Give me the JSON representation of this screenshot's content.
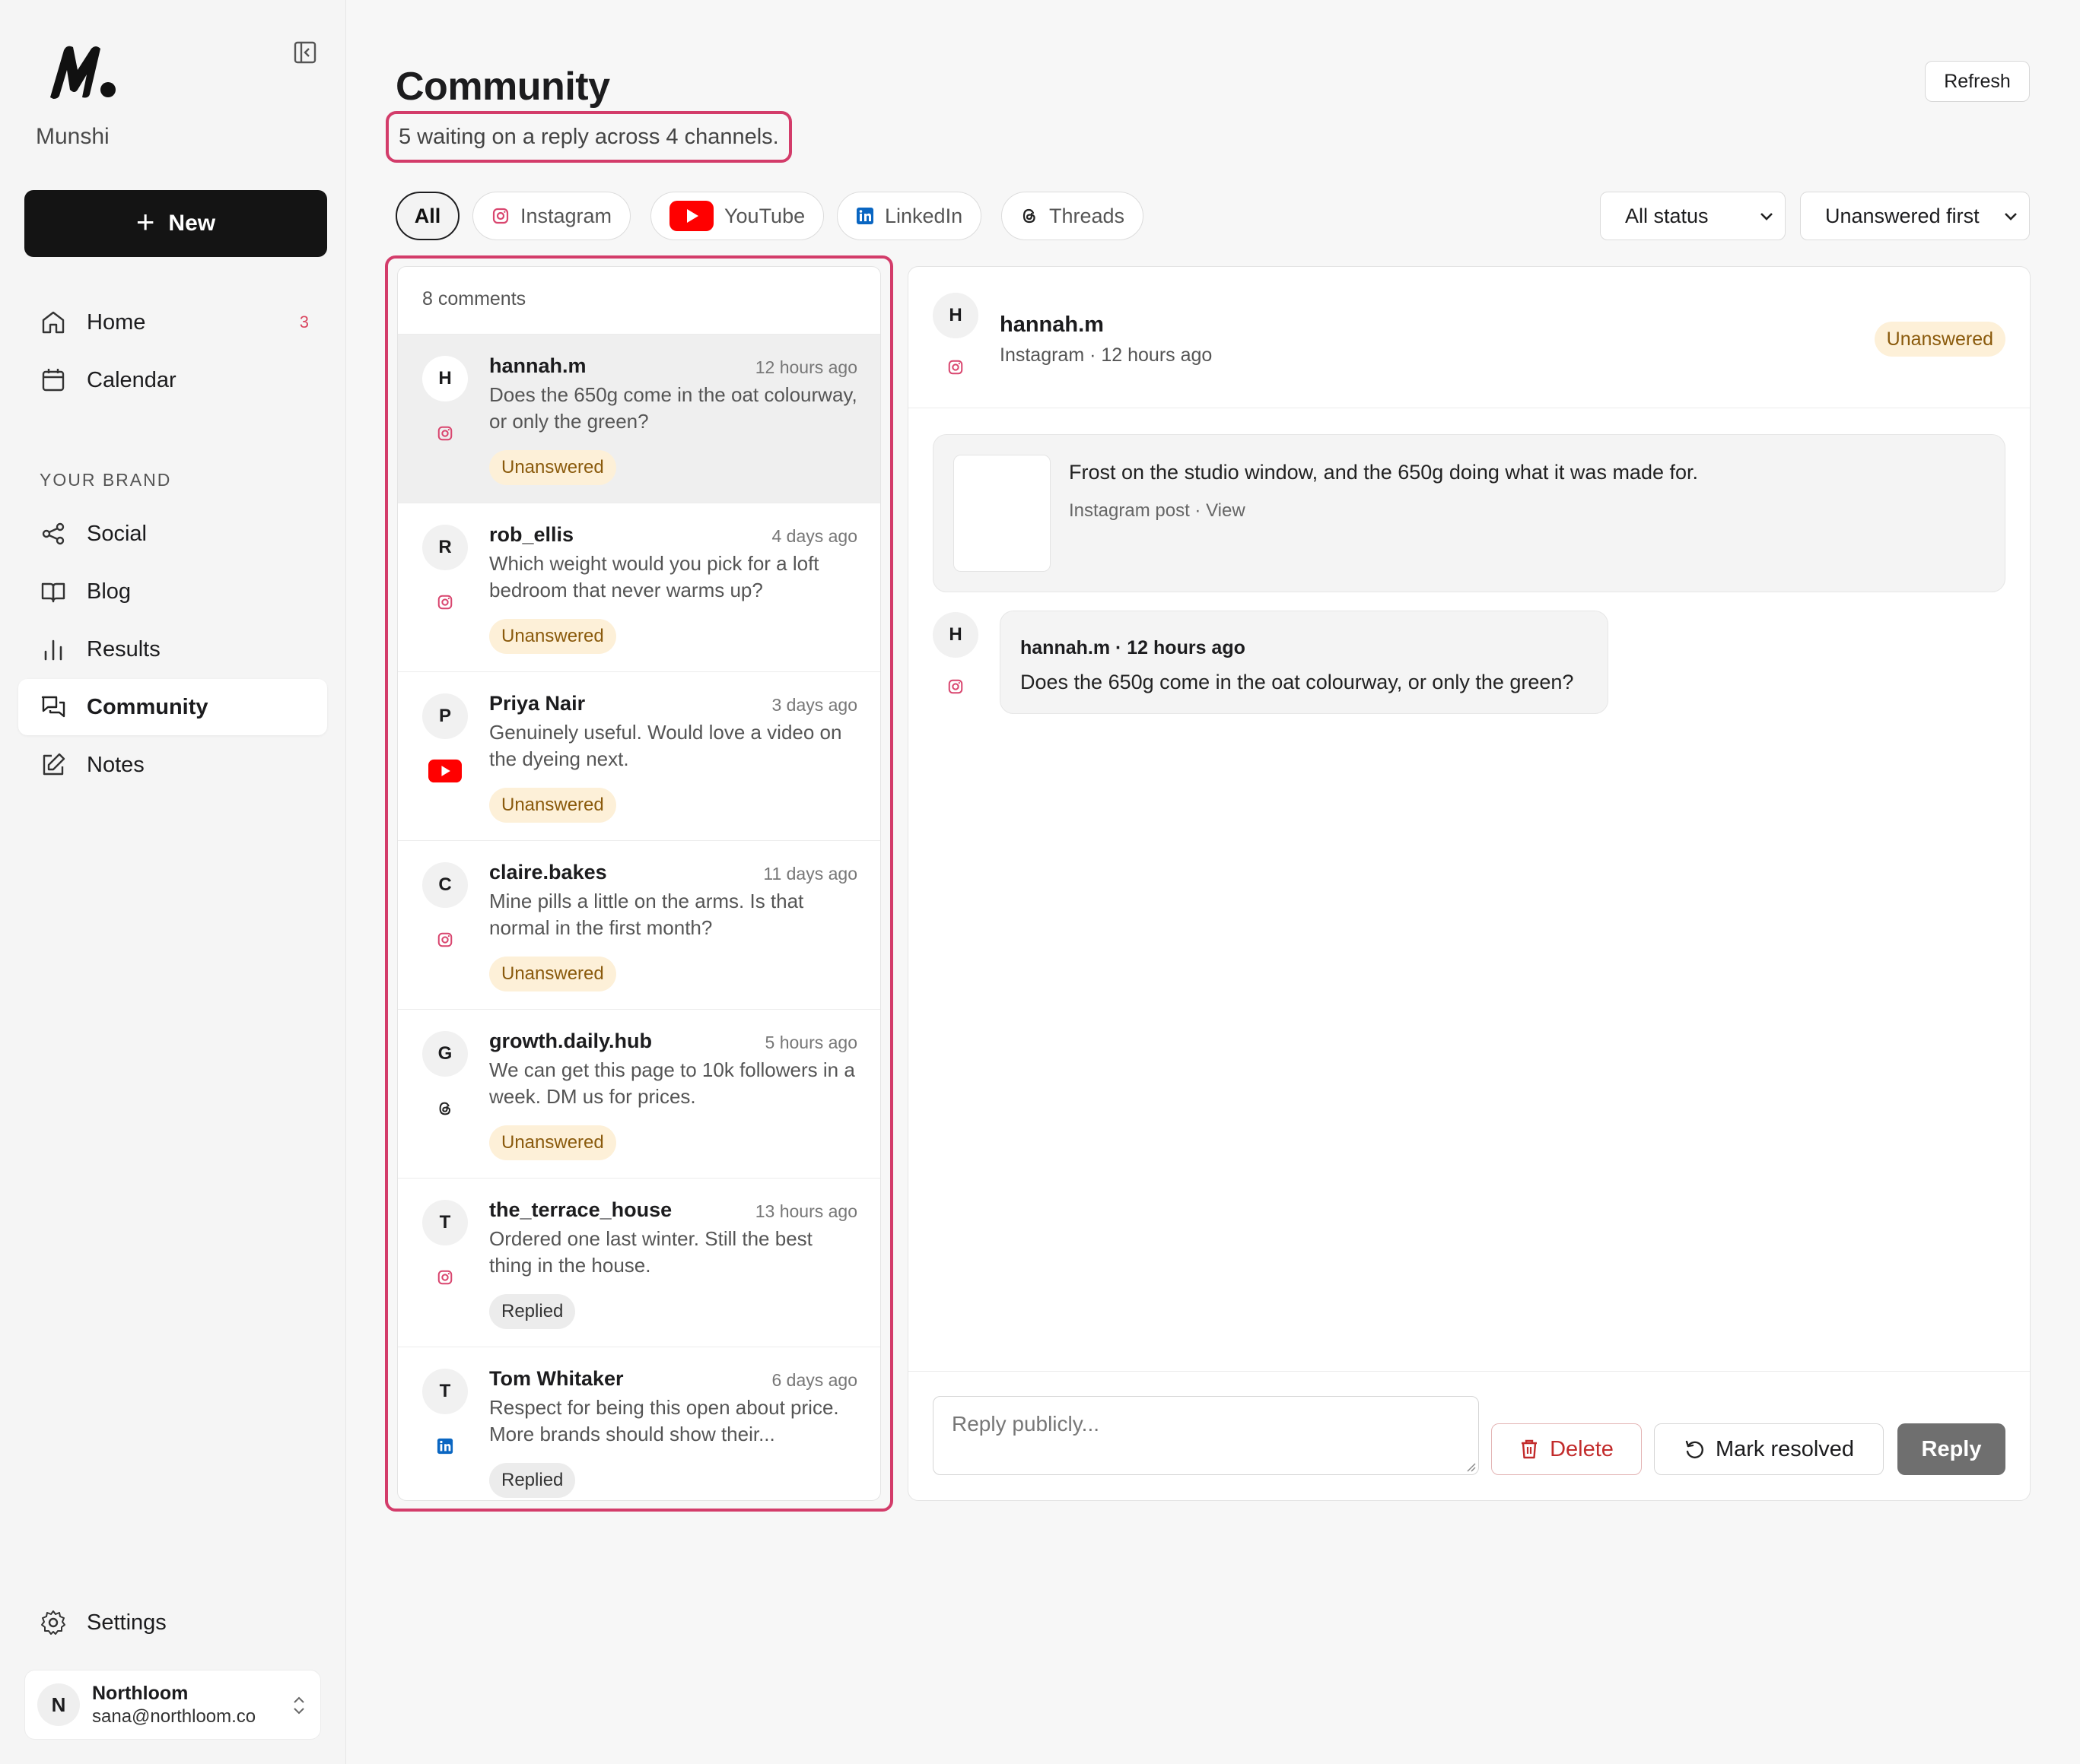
{
  "sidebar": {
    "brand": "Munshi",
    "new_label": "New",
    "nav": [
      {
        "label": "Home",
        "icon": "home-icon",
        "badge": "3"
      },
      {
        "label": "Calendar",
        "icon": "calendar-icon"
      }
    ],
    "section_label": "YOUR BRAND",
    "brand_nav": [
      {
        "label": "Social",
        "icon": "share-icon"
      },
      {
        "label": "Blog",
        "icon": "book-icon"
      },
      {
        "label": "Results",
        "icon": "bar-chart-icon"
      },
      {
        "label": "Community",
        "icon": "chat-icon",
        "active": true
      },
      {
        "label": "Notes",
        "icon": "edit-icon"
      }
    ],
    "settings_label": "Settings",
    "account": {
      "initial": "N",
      "name": "Northloom",
      "email": "sana@northloom.co"
    }
  },
  "header": {
    "title": "Community",
    "subtitle": "5 waiting on a reply across 4 channels.",
    "refresh_label": "Refresh"
  },
  "filters": {
    "channels": [
      {
        "label": "All",
        "active": true
      },
      {
        "label": "Instagram",
        "icon": "instagram-icon"
      },
      {
        "label": "YouTube",
        "icon": "youtube-icon"
      },
      {
        "label": "LinkedIn",
        "icon": "linkedin-icon"
      },
      {
        "label": "Threads",
        "icon": "threads-icon"
      }
    ],
    "status_select": "All status",
    "sort_select": "Unanswered first"
  },
  "list": {
    "count_label": "8 comments",
    "items": [
      {
        "initial": "H",
        "name": "hannah.m",
        "time": "12 hours ago",
        "text": "Does the 650g come in the oat colourway, or only the green?",
        "status": "Unanswered",
        "platform": "instagram"
      },
      {
        "initial": "R",
        "name": "rob_ellis",
        "time": "4 days ago",
        "text": "Which weight would you pick for a loft bedroom that never warms up?",
        "status": "Unanswered",
        "platform": "instagram"
      },
      {
        "initial": "P",
        "name": "Priya Nair",
        "time": "3 days ago",
        "text": "Genuinely useful. Would love a video on the dyeing next.",
        "status": "Unanswered",
        "platform": "youtube"
      },
      {
        "initial": "C",
        "name": "claire.bakes",
        "time": "11 days ago",
        "text": "Mine pills a little on the arms. Is that normal in the first month?",
        "status": "Unanswered",
        "platform": "instagram"
      },
      {
        "initial": "G",
        "name": "growth.daily.hub",
        "time": "5 hours ago",
        "text": "We can get this page to 10k followers in a week. DM us for prices.",
        "status": "Unanswered",
        "platform": "threads"
      },
      {
        "initial": "T",
        "name": "the_terrace_house",
        "time": "13 hours ago",
        "text": "Ordered one last winter. Still the best thing in the house.",
        "status": "Replied",
        "platform": "instagram"
      },
      {
        "initial": "T",
        "name": "Tom Whitaker",
        "time": "6 days ago",
        "text": "Respect for being this open about price. More brands should show their...",
        "status": "Replied",
        "platform": "linkedin"
      }
    ]
  },
  "detail": {
    "initial": "H",
    "name": "hannah.m",
    "meta": "Instagram · 12 hours ago",
    "status": "Unanswered",
    "post": {
      "caption": "Frost on the studio window, and the 650g doing what it was made for.",
      "meta": "Instagram post · View"
    },
    "comment": {
      "initial": "H",
      "meta": "hannah.m · 12 hours ago",
      "text": "Does the 650g come in the oat colourway, or only the green?"
    },
    "reply_placeholder": "Reply publicly...",
    "delete_label": "Delete",
    "resolve_label": "Mark resolved",
    "reply_label": "Reply"
  },
  "colors": {
    "accent_outline": "#d33c6a",
    "instagram": "#d9466f",
    "youtube": "#ff0000",
    "linkedin": "#0a66c2",
    "unanswered_bg": "#fdf0d8",
    "unanswered_text": "#8a5a0c"
  }
}
